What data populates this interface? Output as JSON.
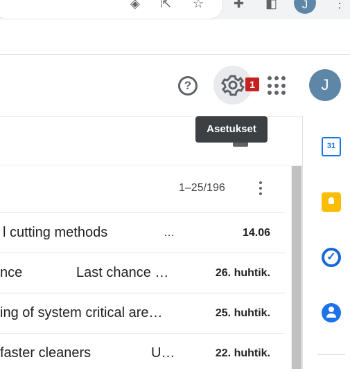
{
  "browser": {
    "avatar_letter": "J"
  },
  "header": {
    "help_glyph": "?",
    "settings_badge": "1",
    "settings_tooltip": "Asetukset",
    "avatar_letter": "J"
  },
  "list": {
    "pager": "1–25/196",
    "rows": [
      {
        "subject": "l cutting methods",
        "snippet": "…",
        "date": "14.06"
      },
      {
        "subject": "nce",
        "snippet": "Last chance …",
        "date": "26. huhtik."
      },
      {
        "subject": "ing of system critical are…",
        "snippet": "",
        "date": "25. huhtik."
      },
      {
        "subject": " faster cleaners",
        "snippet": "U…",
        "date": "22. huhtik."
      }
    ]
  },
  "side_panel": {
    "calendar_day": "31"
  },
  "colors": {
    "avatar": "#5e86a6",
    "badge": "#c5221f",
    "calendar": "#1a73e8",
    "keep": "#fbbc04",
    "tasks": "#1967d2"
  },
  "icons": [
    "eye-slash-icon",
    "share-icon",
    "star-icon",
    "puzzle-icon",
    "side-panel-icon",
    "more-vert-icon",
    "help-icon",
    "gear-icon",
    "apps-grid-icon",
    "calendar-icon",
    "keep-icon",
    "tasks-icon",
    "contacts-icon"
  ]
}
